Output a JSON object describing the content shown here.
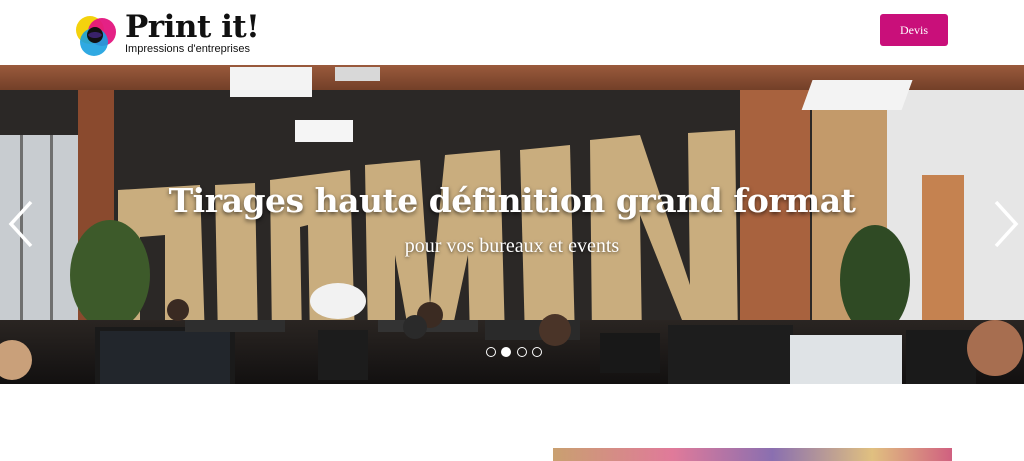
{
  "header": {
    "logo": {
      "title": "Print it!",
      "subtitle": "Impressions d'entreprises"
    },
    "cta_label": "Devis"
  },
  "hero": {
    "title": "Tirages haute définition grand format",
    "subtitle": "pour vos bureaux et events",
    "carousel": {
      "slide_count": 4,
      "active_index": 1
    }
  },
  "colors": {
    "accent": "#c90f7a"
  },
  "icons": {
    "prev": "chevron-left-icon",
    "next": "chevron-right-icon"
  }
}
